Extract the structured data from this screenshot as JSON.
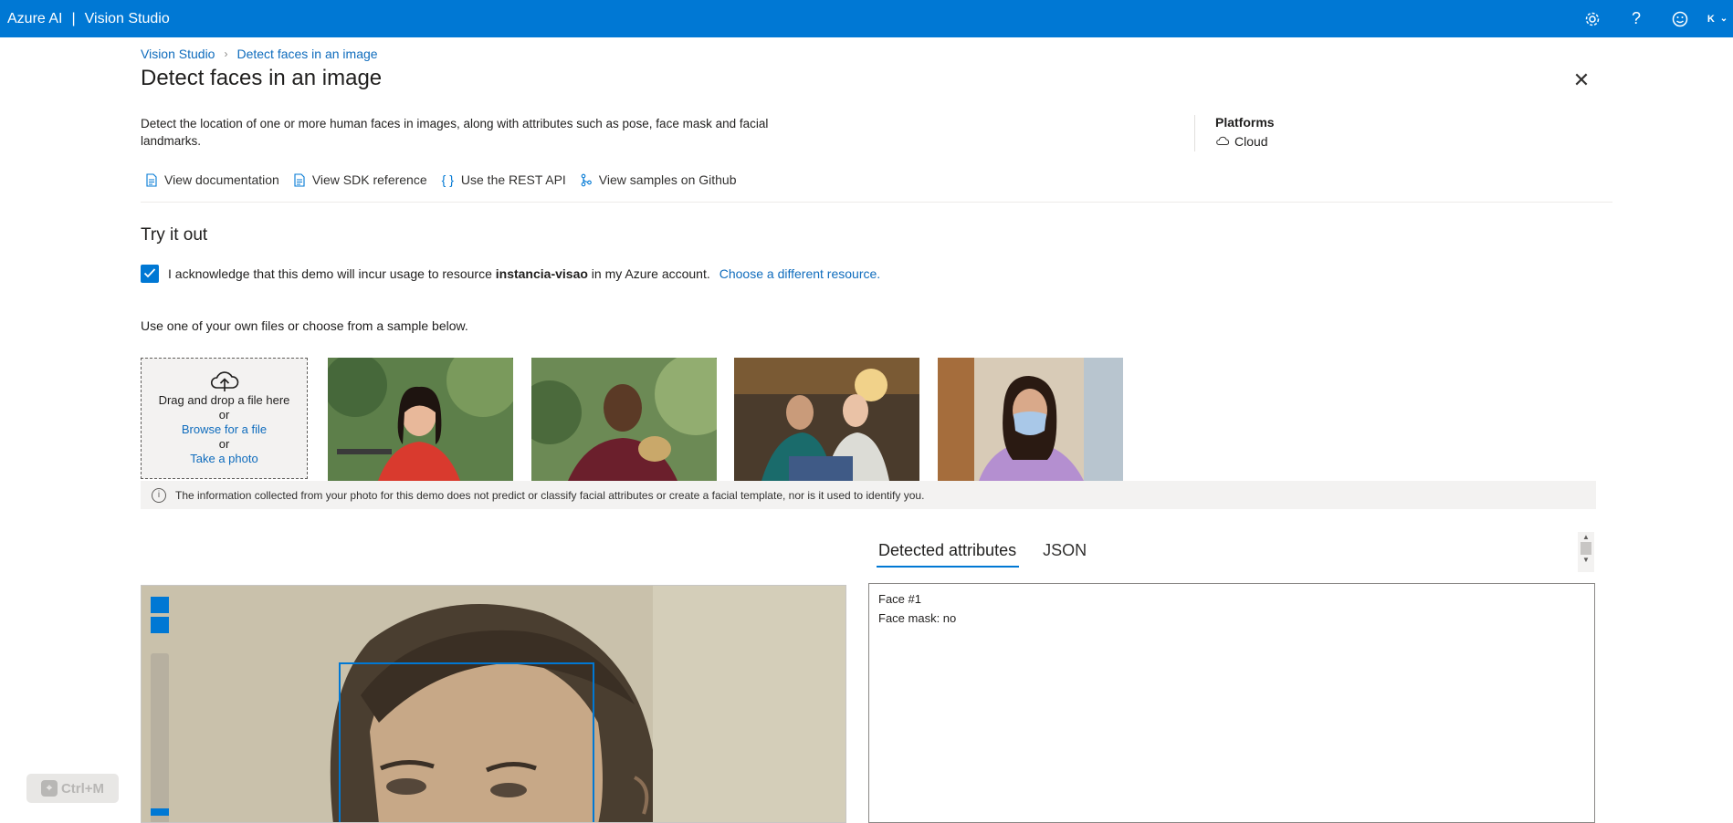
{
  "topbar": {
    "brand": "Azure AI",
    "separator": "|",
    "product": "Vision Studio",
    "avatar": "K"
  },
  "breadcrumb": {
    "home": "Vision Studio",
    "current": "Detect faces in an image"
  },
  "page": {
    "title": "Detect faces in an image",
    "description": "Detect the location of one or more human faces in images, along with attributes such as pose, face mask and facial landmarks."
  },
  "platforms": {
    "title": "Platforms",
    "value": "Cloud"
  },
  "links": [
    {
      "label": "View documentation",
      "icon": "document-icon"
    },
    {
      "label": "View SDK reference",
      "icon": "document-icon"
    },
    {
      "label": "Use the REST API",
      "icon": "braces-icon"
    },
    {
      "label": "View samples on Github",
      "icon": "branch-icon"
    }
  ],
  "try": {
    "title": "Try it out",
    "ack_prefix": "I acknowledge that this demo will incur usage to resource",
    "resource": "instancia-visao",
    "ack_suffix": "in my Azure account.",
    "choose_link": "Choose a different resource.",
    "checked": true
  },
  "samples": {
    "intro": "Use one of your own files or choose from a sample below.",
    "drop_text": "Drag and drop a file here",
    "or": "or",
    "browse": "Browse for a file",
    "photo": "Take a photo"
  },
  "info": "The information collected from your photo for this demo does not predict or classify facial attributes or create a facial template, nor is it used to identify you.",
  "tabs": {
    "detected": "Detected attributes",
    "json": "JSON",
    "active": "detected"
  },
  "results": {
    "face": "Face #1",
    "mask": "Face mask: no"
  },
  "shortcut": "Ctrl+M",
  "colors": {
    "accent": "#0078d4",
    "link": "#0f6cbd",
    "info_bg": "#f3f2f1"
  }
}
